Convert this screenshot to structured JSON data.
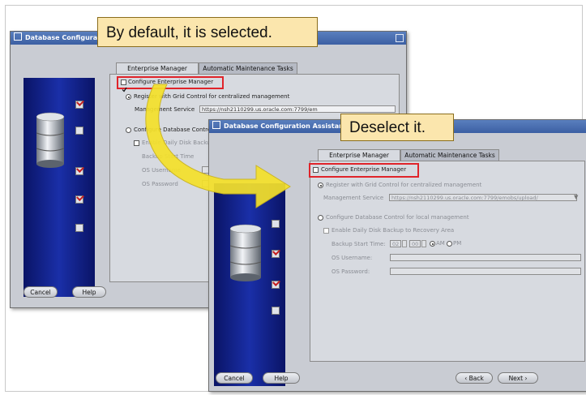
{
  "callouts": {
    "first": "By default, it is selected.",
    "second": "Deselect it."
  },
  "back_window": {
    "title": "Database Configuration",
    "tabs": [
      "Enterprise Manager",
      "Automatic Maintenance Tasks"
    ],
    "configure_em": "Configure Enterprise Manager",
    "register_grid": "Register with Grid Control for centralized management",
    "mgmt_service_label": "Management Service",
    "mgmt_service_value": "https://nsh2110299.us.oracle.com:7799/em",
    "configure_db_control": "Configure Database Control for local management",
    "enable_backup": "Enable Daily Disk Backup to Recovery Area",
    "backup_time_label": "Backup Start Time",
    "os_username_label": "OS Username",
    "os_password_label": "OS Password",
    "cancel": "Cancel",
    "help": "Help"
  },
  "front_window": {
    "title": "Database Configuration Assistant, Step",
    "tabs": [
      "Enterprise Manager",
      "Automatic Maintenance Tasks"
    ],
    "configure_em": "Configure Enterprise Manager",
    "register_grid": "Register with Grid Control for centralized management",
    "mgmt_service_label": "Management Service",
    "mgmt_service_value": "https://nsh2110299.us.oracle.com:7799/emobs/upload/",
    "configure_db_control": "Configure Database Control for local management",
    "enable_backup": "Enable Daily Disk Backup to Recovery Area",
    "backup_time_label": "Backup Start Time:",
    "backup_hour": "02",
    "backup_min": "00",
    "am": "AM",
    "pm": "PM",
    "os_username_label": "OS Username:",
    "os_password_label": "OS Password:",
    "cancel": "Cancel",
    "help": "Help",
    "back": "Back",
    "next": "Next"
  },
  "colors": {
    "callout_bg": "#fbe6ad",
    "highlight": "#e0242a",
    "arrow": "#f5e12a",
    "sidebar": "#1a2fa8"
  }
}
